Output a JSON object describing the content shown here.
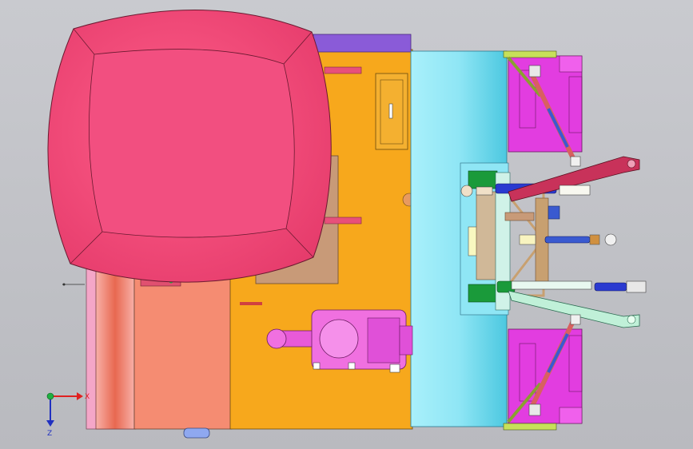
{
  "viewport": {
    "background_top": "#c9cacf",
    "background_bottom": "#b9babf"
  },
  "axes_triad": {
    "x_label": "X",
    "z_label": "Z",
    "x_color": "#e02020",
    "z_color": "#2030c0",
    "origin_color": "#20b040"
  },
  "colors": {
    "seat": "#f0507a",
    "seat_dark": "#c8325a",
    "body_orange": "#f7a81c",
    "body_salmon": "#f58c72",
    "body_pink": "#f4a6c8",
    "drum_cyan": "#7fdff0",
    "magenta": "#e23de0",
    "violet": "#8a5bd8",
    "yellow_green": "#c7e05a",
    "blue": "#2a3ad0",
    "green": "#1a9a3a",
    "tan": "#c89a78",
    "red_arm": "#c8325a"
  }
}
